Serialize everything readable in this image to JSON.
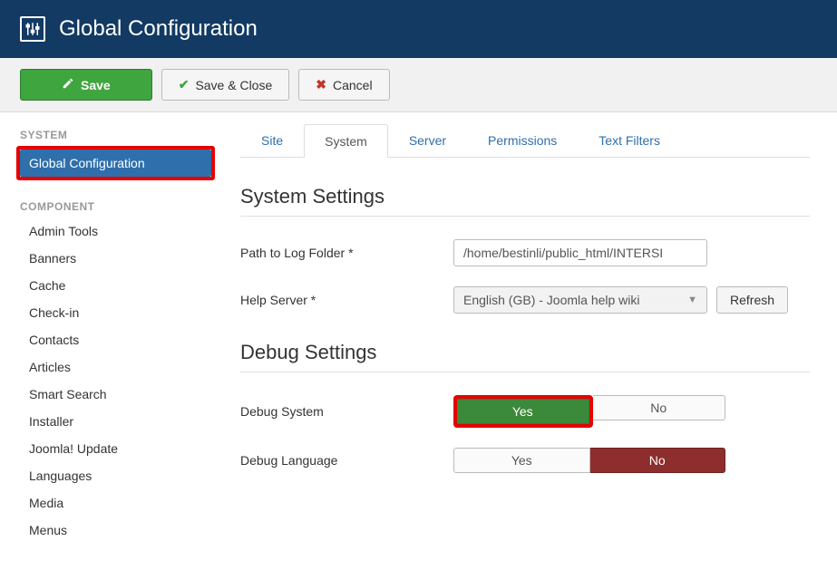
{
  "header": {
    "title": "Global Configuration"
  },
  "toolbar": {
    "save_label": "Save",
    "save_close_label": "Save & Close",
    "cancel_label": "Cancel"
  },
  "sidebar": {
    "system_heading": "SYSTEM",
    "global_config_label": "Global Configuration",
    "component_heading": "COMPONENT",
    "items": [
      {
        "label": "Admin Tools"
      },
      {
        "label": "Banners"
      },
      {
        "label": "Cache"
      },
      {
        "label": "Check-in"
      },
      {
        "label": "Contacts"
      },
      {
        "label": "Articles"
      },
      {
        "label": "Smart Search"
      },
      {
        "label": "Installer"
      },
      {
        "label": "Joomla! Update"
      },
      {
        "label": "Languages"
      },
      {
        "label": "Media"
      },
      {
        "label": "Menus"
      }
    ]
  },
  "tabs": {
    "site": "Site",
    "system": "System",
    "server": "Server",
    "permissions": "Permissions",
    "text_filters": "Text Filters"
  },
  "sections": {
    "system_settings_title": "System Settings",
    "debug_settings_title": "Debug Settings"
  },
  "form": {
    "path_log_label": "Path to Log Folder *",
    "path_log_value": "/home/bestinli/public_html/INTERSI",
    "help_server_label": "Help Server *",
    "help_server_value": "English (GB) - Joomla help wiki",
    "refresh_label": "Refresh",
    "debug_system_label": "Debug System",
    "debug_language_label": "Debug Language",
    "yes_label": "Yes",
    "no_label": "No"
  }
}
